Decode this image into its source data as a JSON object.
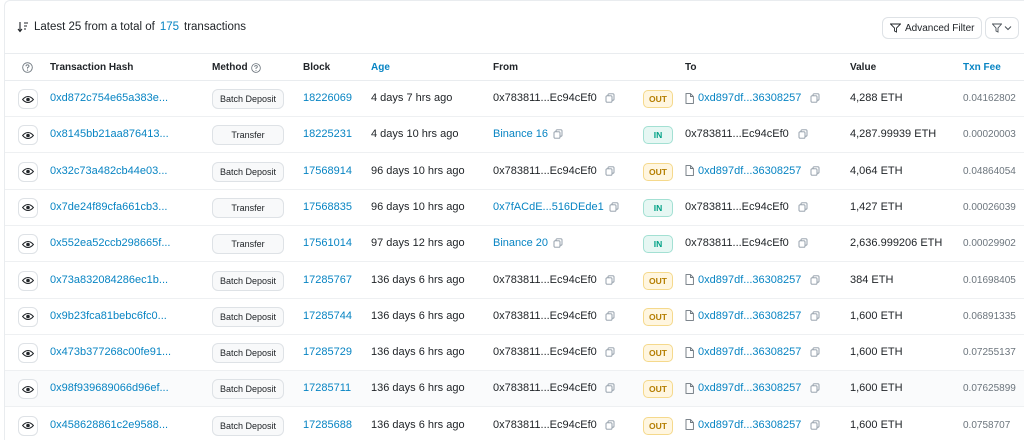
{
  "header": {
    "summary_prefix": "Latest 25 from a total of",
    "total": "175",
    "summary_suffix": "transactions",
    "advanced_filter_label": "Advanced Filter"
  },
  "columns": {
    "hash": "Transaction Hash",
    "method": "Method",
    "block": "Block",
    "age": "Age",
    "from": "From",
    "to": "To",
    "value": "Value",
    "fee": "Txn Fee"
  },
  "colors": {
    "link": "#0784c3",
    "out": "#b47d00",
    "in": "#00a186"
  },
  "rows": [
    {
      "hash": "0xd872c754e65a383e...",
      "method": "Batch Deposit",
      "block": "18226069",
      "age": "4 days 7 hrs ago",
      "from": "0x783811...Ec94cEf0",
      "from_link": false,
      "dir": "OUT",
      "to": "0xd897df...36308257",
      "to_contract": true,
      "value": "4,288 ETH",
      "fee": "0.04162802"
    },
    {
      "hash": "0x8145bb21aa876413...",
      "method": "Transfer",
      "block": "18225231",
      "age": "4 days 10 hrs ago",
      "from": "Binance 16",
      "from_link": true,
      "dir": "IN",
      "to": "0x783811...Ec94cEf0",
      "to_contract": false,
      "value": "4,287.99939 ETH",
      "fee": "0.00020003"
    },
    {
      "hash": "0x32c73a482cb44e03...",
      "method": "Batch Deposit",
      "block": "17568914",
      "age": "96 days 10 hrs ago",
      "from": "0x783811...Ec94cEf0",
      "from_link": false,
      "dir": "OUT",
      "to": "0xd897df...36308257",
      "to_contract": true,
      "value": "4,064 ETH",
      "fee": "0.04864054"
    },
    {
      "hash": "0x7de24f89cfa661cb3...",
      "method": "Transfer",
      "block": "17568835",
      "age": "96 days 10 hrs ago",
      "from": "0x7fACdE...516DEde1",
      "from_link": true,
      "dir": "IN",
      "to": "0x783811...Ec94cEf0",
      "to_contract": false,
      "value": "1,427 ETH",
      "fee": "0.00026039"
    },
    {
      "hash": "0x552ea52ccb298665f...",
      "method": "Transfer",
      "block": "17561014",
      "age": "97 days 12 hrs ago",
      "from": "Binance 20",
      "from_link": true,
      "dir": "IN",
      "to": "0x783811...Ec94cEf0",
      "to_contract": false,
      "value": "2,636.999206 ETH",
      "fee": "0.00029902"
    },
    {
      "hash": "0x73a832084286ec1b...",
      "method": "Batch Deposit",
      "block": "17285767",
      "age": "136 days 6 hrs ago",
      "from": "0x783811...Ec94cEf0",
      "from_link": false,
      "dir": "OUT",
      "to": "0xd897df...36308257",
      "to_contract": true,
      "value": "384 ETH",
      "fee": "0.01698405"
    },
    {
      "hash": "0x9b23fca81bebc6fc0...",
      "method": "Batch Deposit",
      "block": "17285744",
      "age": "136 days 6 hrs ago",
      "from": "0x783811...Ec94cEf0",
      "from_link": false,
      "dir": "OUT",
      "to": "0xd897df...36308257",
      "to_contract": true,
      "value": "1,600 ETH",
      "fee": "0.06891335"
    },
    {
      "hash": "0x473b377268c00fe91...",
      "method": "Batch Deposit",
      "block": "17285729",
      "age": "136 days 6 hrs ago",
      "from": "0x783811...Ec94cEf0",
      "from_link": false,
      "dir": "OUT",
      "to": "0xd897df...36308257",
      "to_contract": true,
      "value": "1,600 ETH",
      "fee": "0.07255137"
    },
    {
      "hash": "0x98f939689066d96ef...",
      "method": "Batch Deposit",
      "block": "17285711",
      "age": "136 days 6 hrs ago",
      "from": "0x783811...Ec94cEf0",
      "from_link": false,
      "dir": "OUT",
      "to": "0xd897df...36308257",
      "to_contract": true,
      "value": "1,600 ETH",
      "fee": "0.07625899"
    },
    {
      "hash": "0x458628861c2e9588...",
      "method": "Batch Deposit",
      "block": "17285688",
      "age": "136 days 6 hrs ago",
      "from": "0x783811...Ec94cEf0",
      "from_link": false,
      "dir": "OUT",
      "to": "0xd897df...36308257",
      "to_contract": true,
      "value": "1,600 ETH",
      "fee": "0.0758707"
    }
  ]
}
